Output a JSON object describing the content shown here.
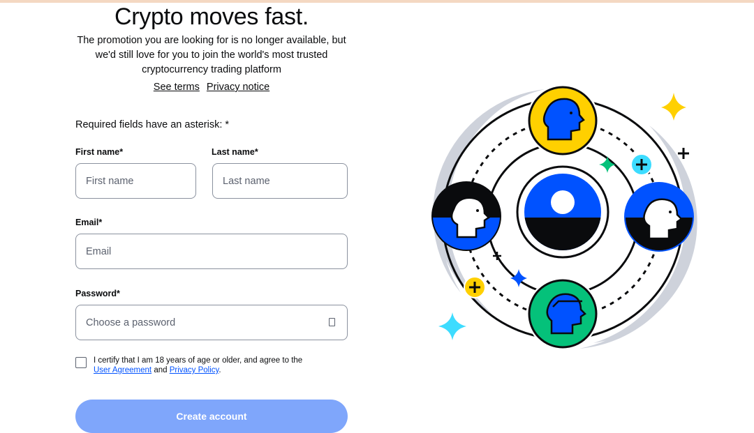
{
  "headline": "Crypto moves fast.",
  "subtitle": "The promotion you are looking for is no longer available, but we'd still love for you to join the world's most trusted cryptocurrency trading platform",
  "links": {
    "see_terms": "See terms",
    "privacy_notice": "Privacy notice"
  },
  "form": {
    "required_note": "Required fields have an asterisk: *",
    "first_name": {
      "label": "First name*",
      "placeholder": "First name",
      "value": ""
    },
    "last_name": {
      "label": "Last name*",
      "placeholder": "Last name",
      "value": ""
    },
    "email": {
      "label": "Email*",
      "placeholder": "Email",
      "value": ""
    },
    "password": {
      "label": "Password*",
      "placeholder": "Choose a password",
      "value": ""
    },
    "certify": {
      "checked": false,
      "text_before": "I certify that I am 18 years of age or older, and agree to the",
      "user_agreement": "User Agreement",
      "and": "and",
      "privacy_policy": "Privacy Policy",
      "period": "."
    },
    "submit_label": "Create account"
  },
  "icons": {
    "password_toggle": "eye-icon",
    "illustration": "community-network-illustration"
  },
  "colors": {
    "brand_blue": "#0052ff",
    "button_disabled": "#7fa6fb",
    "yellow": "#ffd000",
    "green": "#05c17a",
    "cyan": "#3ddcff"
  }
}
